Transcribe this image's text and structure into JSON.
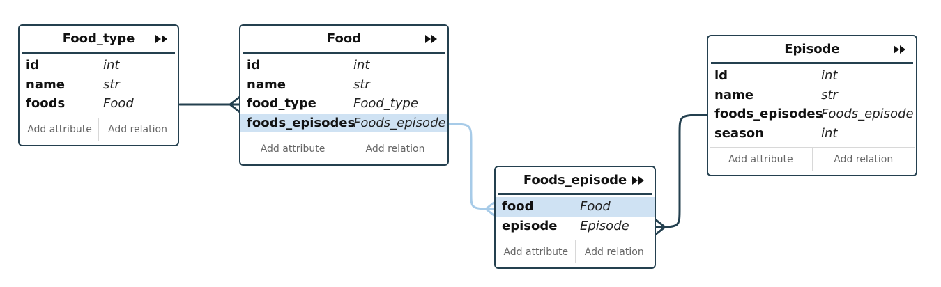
{
  "colors": {
    "border": "#24404f",
    "highlight_row": "#cfe2f3",
    "highlight_link": "#a7cbe8",
    "link": "#24404f"
  },
  "icons": {
    "expand": "double-chevron-right-icon"
  },
  "footer": {
    "add_attribute": "Add attribute",
    "add_relation": "Add relation"
  },
  "entities": {
    "food_type": {
      "title": "Food_type",
      "attributes": [
        {
          "name": "id",
          "type": "int"
        },
        {
          "name": "name",
          "type": "str"
        },
        {
          "name": "foods",
          "type": "Food"
        }
      ]
    },
    "food": {
      "title": "Food",
      "attributes": [
        {
          "name": "id",
          "type": "int"
        },
        {
          "name": "name",
          "type": "str"
        },
        {
          "name": "food_type",
          "type": "Food_type"
        },
        {
          "name": "foods_episodes",
          "type": "Foods_episode",
          "selected": true
        }
      ]
    },
    "foods_episode": {
      "title": "Foods_episode",
      "attributes": [
        {
          "name": "food",
          "type": "Food",
          "selected": true
        },
        {
          "name": "episode",
          "type": "Episode"
        }
      ]
    },
    "episode": {
      "title": "Episode",
      "attributes": [
        {
          "name": "id",
          "type": "int"
        },
        {
          "name": "name",
          "type": "str"
        },
        {
          "name": "foods_episodes",
          "type": "Foods_episode"
        },
        {
          "name": "season",
          "type": "int"
        }
      ]
    }
  }
}
